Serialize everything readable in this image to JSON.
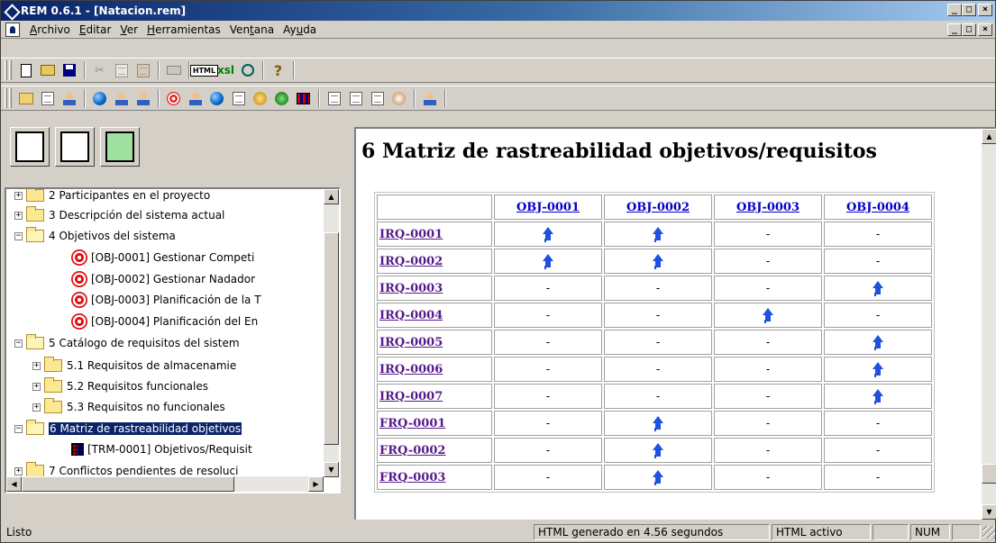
{
  "window": {
    "title": "REM 0.6.1 - [Natacion.rem]",
    "min": "_",
    "max": "□",
    "close": "×"
  },
  "menu": {
    "items": [
      {
        "key": "A",
        "rest": "rchivo"
      },
      {
        "key": "E",
        "rest": "ditar"
      },
      {
        "key": "V",
        "rest": "er"
      },
      {
        "key": "H",
        "rest": "erramientas"
      },
      {
        "pre": "Ven",
        "key": "t",
        "rest": "ana"
      },
      {
        "pre": "Ay",
        "key": "u",
        "rest": "da"
      }
    ]
  },
  "toolbar": {
    "html_label": "HTML",
    "xsl_label": "xsl",
    "help_label": "?"
  },
  "tree": {
    "rows": [
      {
        "expander": "+",
        "label": "2 Participantes en el proyecto"
      },
      {
        "expander": "+",
        "label": "3 Descripción del sistema actual"
      },
      {
        "expander": "−",
        "label": "4 Objetivos del sistema"
      },
      {
        "label": "[OBJ-0001] Gestionar Competi"
      },
      {
        "label": "[OBJ-0002] Gestionar Nadador"
      },
      {
        "label": "[OBJ-0003] Planificación de la T"
      },
      {
        "label": "[OBJ-0004] Planificación del En"
      },
      {
        "expander": "−",
        "label": "5 Catálogo de requisitos del sistem"
      },
      {
        "expander": "+",
        "label": "5.1 Requisitos de almacenamie"
      },
      {
        "expander": "+",
        "label": "5.2 Requisitos funcionales"
      },
      {
        "expander": "+",
        "label": "5.3 Requisitos no funcionales"
      },
      {
        "expander": "−",
        "label": "6 Matriz de rastreabilidad objetivos"
      },
      {
        "label": "[TRM-0001] Objetivos/Requisit"
      },
      {
        "expander": "+",
        "label": "7 Conflictos pendientes de resoluci"
      }
    ]
  },
  "document": {
    "title": "6 Matriz de rastreabilidad objetivos/requisitos",
    "columns": [
      "OBJ-0001",
      "OBJ-0002",
      "OBJ-0003",
      "OBJ-0004"
    ],
    "rows": [
      {
        "id": "IRQ-0001",
        "cells": [
          "up",
          "up",
          "-",
          "-"
        ]
      },
      {
        "id": "IRQ-0002",
        "cells": [
          "up",
          "up",
          "-",
          "-"
        ]
      },
      {
        "id": "IRQ-0003",
        "cells": [
          "-",
          "-",
          "-",
          "up"
        ]
      },
      {
        "id": "IRQ-0004",
        "cells": [
          "-",
          "-",
          "up",
          "-"
        ]
      },
      {
        "id": "IRQ-0005",
        "cells": [
          "-",
          "-",
          "-",
          "up"
        ]
      },
      {
        "id": "IRQ-0006",
        "cells": [
          "-",
          "-",
          "-",
          "up"
        ]
      },
      {
        "id": "IRQ-0007",
        "cells": [
          "-",
          "-",
          "-",
          "up"
        ]
      },
      {
        "id": "FRQ-0001",
        "cells": [
          "-",
          "up",
          "-",
          "-"
        ]
      },
      {
        "id": "FRQ-0002",
        "cells": [
          "-",
          "up",
          "-",
          "-"
        ]
      },
      {
        "id": "FRQ-0003",
        "cells": [
          "-",
          "up",
          "-",
          "-"
        ]
      }
    ]
  },
  "status": {
    "main": "Listo",
    "html_time": "HTML generado en 4.56 segundos",
    "html_active": "HTML activo",
    "blank": "",
    "num": "NUM"
  },
  "colors": {
    "title_gradient_start": "#0a246a",
    "link_visited": "#551a8b",
    "link": "#0000cc",
    "trace_arrow": "#2050e0",
    "target_red": "#e01010"
  }
}
